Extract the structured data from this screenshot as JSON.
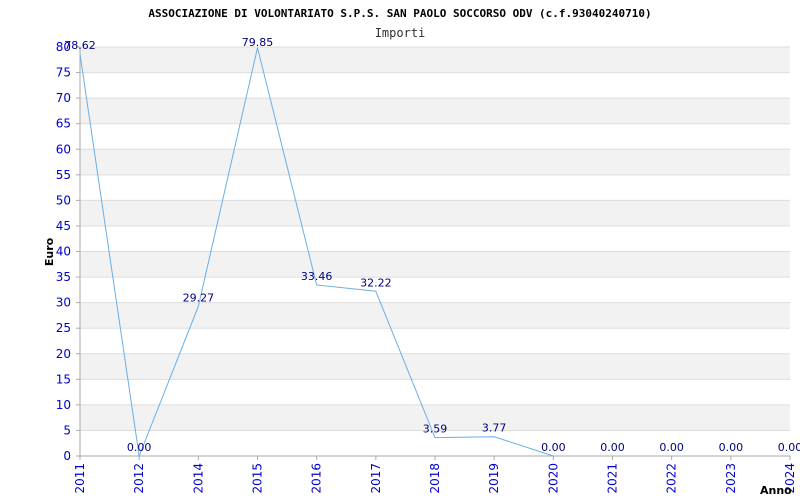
{
  "chart_data": {
    "type": "line",
    "title": "ASSOCIAZIONE DI VOLONTARIATO S.P.S. SAN PAOLO SOCCORSO ODV (c.f.93040240710)",
    "subtitle": "Importi",
    "xlabel": "Anno",
    "ylabel": "Euro",
    "ylim": [
      0,
      80
    ],
    "y_ticks": [
      0,
      5,
      10,
      15,
      20,
      25,
      30,
      35,
      40,
      45,
      50,
      55,
      60,
      65,
      70,
      75,
      80
    ],
    "grid": true,
    "categories": [
      "2011",
      "2012",
      "2014",
      "2015",
      "2016",
      "2017",
      "2018",
      "2019",
      "2020",
      "2021",
      "2022",
      "2023",
      "2024"
    ],
    "series": [
      {
        "values": [
          78.62,
          0.0,
          29.27,
          79.85,
          33.46,
          32.22,
          3.59,
          3.77,
          0.0,
          0.0,
          0.0,
          0.0,
          0.0
        ],
        "labels": [
          "78.62",
          "0.00",
          "29.27",
          "79.85",
          "33.46",
          "32.22",
          "3.59",
          "3.77",
          "0.00",
          "0.00",
          "0.00",
          "0.00",
          "0.00"
        ],
        "line_points": 9
      }
    ],
    "colors": {
      "line": "#6aaee6",
      "axis_text": "#0000cc",
      "label_text": "#000080",
      "band": "#f2f2f2",
      "grid": "#dddddd"
    }
  }
}
